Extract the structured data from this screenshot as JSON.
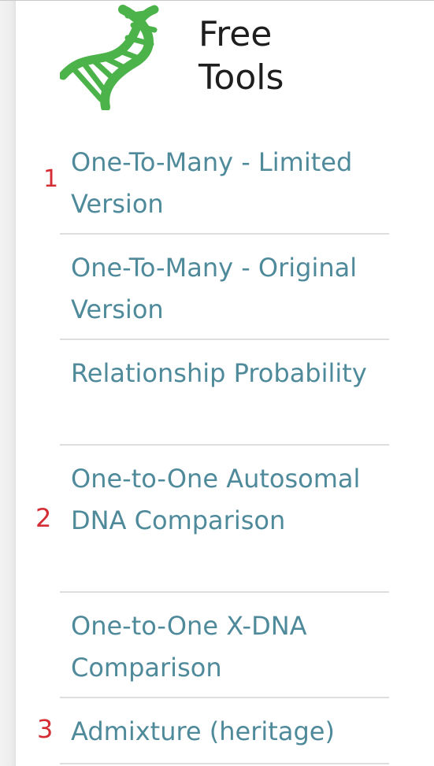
{
  "header": {
    "logo_icon": "dna-icon",
    "logo_color": "#4cb34a",
    "title": "Free\nTools"
  },
  "tools": [
    {
      "label": "One-To-Many - Limited Version"
    },
    {
      "label": "One-To-Many - Original Version"
    },
    {
      "label": "Relationship Probability"
    },
    {
      "label": "One-to-One Autosomal DNA Comparison"
    },
    {
      "label": "One-to-One X-DNA Comparison"
    },
    {
      "label": "Admixture (heritage)"
    }
  ],
  "markers": [
    "1",
    "2",
    "3"
  ],
  "colors": {
    "link": "#4f8a9b",
    "marker": "#d42d34",
    "divider": "#dedede"
  }
}
